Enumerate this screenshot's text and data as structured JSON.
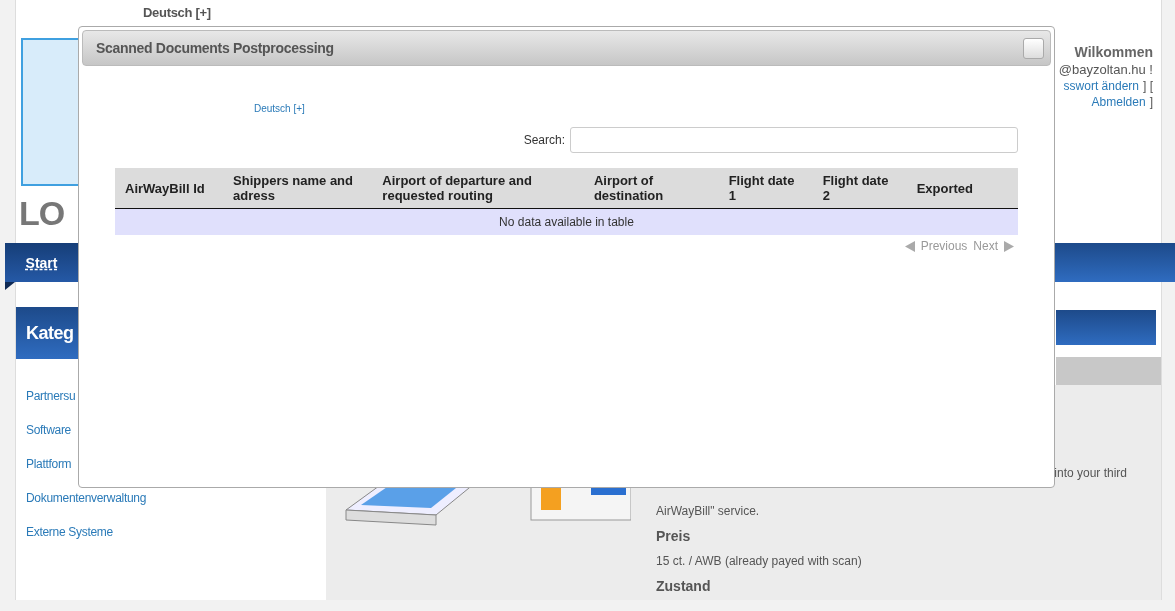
{
  "page": {
    "language_link": "Deutsch [+]",
    "logo_text": "LO",
    "user": {
      "greeting": "Wilkommen",
      "email": "@bayzoltan.hu !",
      "change_password": "sswort ändern",
      "bracket_mid": "] [",
      "logout": "Abmelden",
      "bracket_end": "]"
    },
    "nav": [
      {
        "label": "Start",
        "selected": true
      }
    ],
    "sidebar": {
      "title": "Kateg",
      "items": [
        "Partnersu",
        "Software",
        "Plattform",
        "Dokumentenverwaltung",
        "Externe Systeme"
      ]
    },
    "product": {
      "description_end": "into your third",
      "description_last": "AirWayBill\" service.",
      "sections": [
        {
          "heading": "Preis",
          "text": "15 ct. / AWB (already payed with scan)"
        },
        {
          "heading": "Zustand"
        }
      ]
    }
  },
  "dialog": {
    "title": "Scanned Documents Postprocessing",
    "language_link": "Deutsch [+]",
    "search": {
      "label": "Search:"
    },
    "table": {
      "columns": [
        "AirWayBill Id",
        "Shippers name and adress",
        "Airport of departure and requested routing",
        "Airport of destination",
        "Flight date 1",
        "Flight date 2",
        "Exported"
      ],
      "empty_message": "No data available in table"
    },
    "pagination": {
      "previous": "Previous",
      "next": "Next"
    }
  }
}
